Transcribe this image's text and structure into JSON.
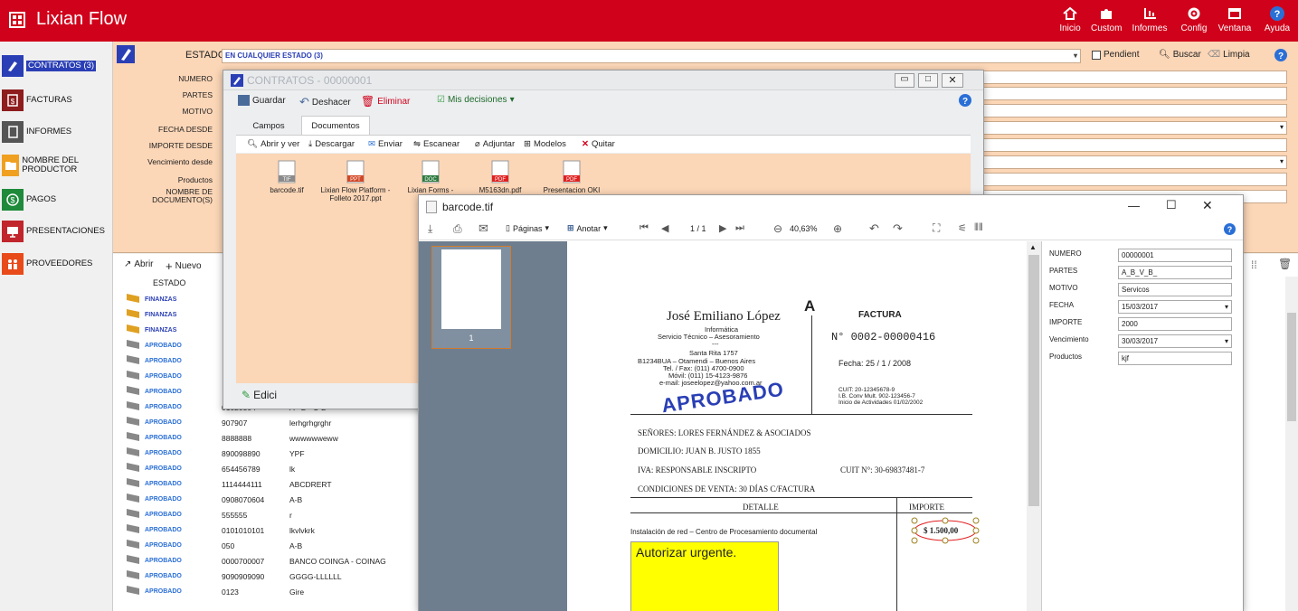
{
  "app": {
    "title": "Lixian Flow"
  },
  "topnav": [
    {
      "label": "Inicio",
      "icon": "home-icon"
    },
    {
      "label": "Custom",
      "icon": "puzzle-icon"
    },
    {
      "label": "Informes",
      "icon": "report-icon"
    },
    {
      "label": "Config",
      "icon": "gear-icon"
    },
    {
      "label": "Ventana",
      "icon": "window-icon"
    },
    {
      "label": "Ayuda",
      "icon": "help-icon"
    }
  ],
  "sidebar": {
    "items": [
      {
        "label": "CONTRATOS (3)",
        "icon": "contract-icon",
        "active": true
      },
      {
        "label": "FACTURAS",
        "icon": "invoice-icon"
      },
      {
        "label": "INFORMES",
        "icon": "report-icon"
      },
      {
        "label": "NOMBRE DEL PRODUCTOR",
        "icon": "folder-icon"
      },
      {
        "label": "PAGOS",
        "icon": "money-icon"
      },
      {
        "label": "PRESENTACIONES",
        "icon": "presentation-icon"
      },
      {
        "label": "PROVEEDORES",
        "icon": "people-icon"
      }
    ]
  },
  "filters": {
    "estado_label": "ESTADO",
    "estado_value": "EN CUALQUIER ESTADO (3)",
    "pendient_label": "Pendient",
    "buscar_label": "Buscar",
    "limpia_label": "Limpia",
    "labels": [
      "NUMERO",
      "PARTES",
      "MOTIVO",
      "FECHA DESDE",
      "IMPORTE DESDE",
      "Vencimiento desde",
      "Productos",
      "NOMBRE DE DOCUMENTO(S)"
    ]
  },
  "list": {
    "abrir_label": "Abrir",
    "nuevo_label": "Nuevo",
    "estado_header": "ESTADO",
    "rows": [
      {
        "estado": "FINANZAS",
        "numero": "",
        "partes": ""
      },
      {
        "estado": "FINANZAS",
        "numero": "",
        "partes": ""
      },
      {
        "estado": "FINANZAS",
        "numero": "",
        "partes": ""
      },
      {
        "estado": "APROBADO",
        "numero": "",
        "partes": ""
      },
      {
        "estado": "APROBADO",
        "numero": "",
        "partes": ""
      },
      {
        "estado": "APROBADO",
        "numero": "",
        "partes": ""
      },
      {
        "estado": "APROBADO",
        "numero": "",
        "partes": ""
      },
      {
        "estado": "APROBADO",
        "numero": "01020304",
        "partes": "A - B - C-D"
      },
      {
        "estado": "APROBADO",
        "numero": "907907",
        "partes": "lerhgrhgrghr"
      },
      {
        "estado": "APROBADO",
        "numero": "8888888",
        "partes": "wwwwwweww"
      },
      {
        "estado": "APROBADO",
        "numero": "890098890",
        "partes": "YPF"
      },
      {
        "estado": "APROBADO",
        "numero": "654456789",
        "partes": "lk"
      },
      {
        "estado": "APROBADO",
        "numero": "1114444111",
        "partes": "ABCDRERT"
      },
      {
        "estado": "APROBADO",
        "numero": "0908070604",
        "partes": "A-B"
      },
      {
        "estado": "APROBADO",
        "numero": "555555",
        "partes": "r"
      },
      {
        "estado": "APROBADO",
        "numero": "0101010101",
        "partes": "lkvlvkrk"
      },
      {
        "estado": "APROBADO",
        "numero": "050",
        "partes": "A-B"
      },
      {
        "estado": "APROBADO",
        "numero": "0000700007",
        "partes": "BANCO COINGA - COINAG"
      },
      {
        "estado": "APROBADO",
        "numero": "9090909090",
        "partes": "GGGG-LLLLLL"
      },
      {
        "estado": "APROBADO",
        "numero": "0123",
        "partes": "Gire"
      }
    ]
  },
  "contratos_window": {
    "title": "CONTRATOS - 00000001",
    "toolbar": {
      "guardar": "Guardar",
      "deshacer": "Deshacer",
      "eliminar": "Eliminar",
      "decisiones": "Mis decisiones"
    },
    "tabs": [
      "Campos",
      "Documentos"
    ],
    "doc_toolbar": {
      "abrir": "Abrir y ver",
      "descargar": "Descargar",
      "enviar": "Enviar",
      "escanear": "Escanear",
      "adjuntar": "Adjuntar",
      "modelos": "Modelos",
      "quitar": "Quitar"
    },
    "files": [
      {
        "name": "barcode.tif",
        "badge": "TIF",
        "color": "#8a8a8a"
      },
      {
        "name": "Lixian Flow Platform - Folleto 2017.ppt",
        "badge": "PPT",
        "color": "#d24726"
      },
      {
        "name": "Lixian Forms - ejemplo",
        "badge": "DOC",
        "color": "#2b7a3d"
      },
      {
        "name": "M5163dn.pdf",
        "badge": "PDF",
        "color": "#e02020"
      },
      {
        "name": "Presentacion OKI",
        "badge": "PDF",
        "color": "#e02020"
      }
    ],
    "edit_label": "Edici"
  },
  "viewer": {
    "title": "barcode.tif",
    "paginas": "Páginas",
    "anotar": "Anotar",
    "page_counter": "1 / 1",
    "zoom": "40,63%",
    "thumb_page": "1",
    "fields": [
      {
        "label": "NUMERO",
        "value": "00000001",
        "dropdown": false
      },
      {
        "label": "PARTES",
        "value": "A_B_V_B_",
        "dropdown": false
      },
      {
        "label": "MOTIVO",
        "value": "Servicos",
        "dropdown": false
      },
      {
        "label": "FECHA",
        "value": "15/03/2017",
        "dropdown": true
      },
      {
        "label": "IMPORTE",
        "value": "2000",
        "dropdown": false
      },
      {
        "label": "Vencimiento",
        "value": "30/03/2017",
        "dropdown": true
      },
      {
        "label": "Productos",
        "value": "kjf",
        "dropdown": false
      }
    ]
  },
  "invoice": {
    "name": "José Emiliano López",
    "sub1": "Informática",
    "sub2": "Servicio Técnico – Asesoramiento",
    "sub3": "---",
    "addr1": "Santa Rita 1757",
    "addr2": "B1234BUA – Otamendi – Buenos Aires",
    "addr3": "Tel. / Fax: (011) 4700-0900",
    "addr4": "Móvil: (011) 15-4123-9876",
    "addr5": "e-mail: joseelopez@yahoo.com.ar",
    "type_letter": "A",
    "factura": "FACTURA",
    "numero": "N° 0002-00000416",
    "fecha": "Fecha:  25 / 1 / 2008",
    "cuit": "CUIT:  20-12345678-9",
    "ib": "I.B. Conv Mult. 902-123456-7",
    "inicio": "Inicio de Actividades  01/02/2002",
    "stamp": "APROBADO",
    "senores": "SEÑORES:  LORES FERNÁNDEZ & ASOCIADOS",
    "domicilio": "DOMICILIO:  JUAN B. JUSTO 1855",
    "iva": "IVA: RESPONSABLE INSCRIPTO",
    "cuit2": "CUIT N°: 30-69837481-7",
    "condiciones": "CONDICIONES DE VENTA: 30 DÍAS C/FACTURA",
    "detalle": "DETALLE",
    "importe": "IMPORTE",
    "item": "Instalación de red – Centro de Procesamiento documental",
    "amount": "$ 1.500,00",
    "note": "Autorizar urgente."
  }
}
